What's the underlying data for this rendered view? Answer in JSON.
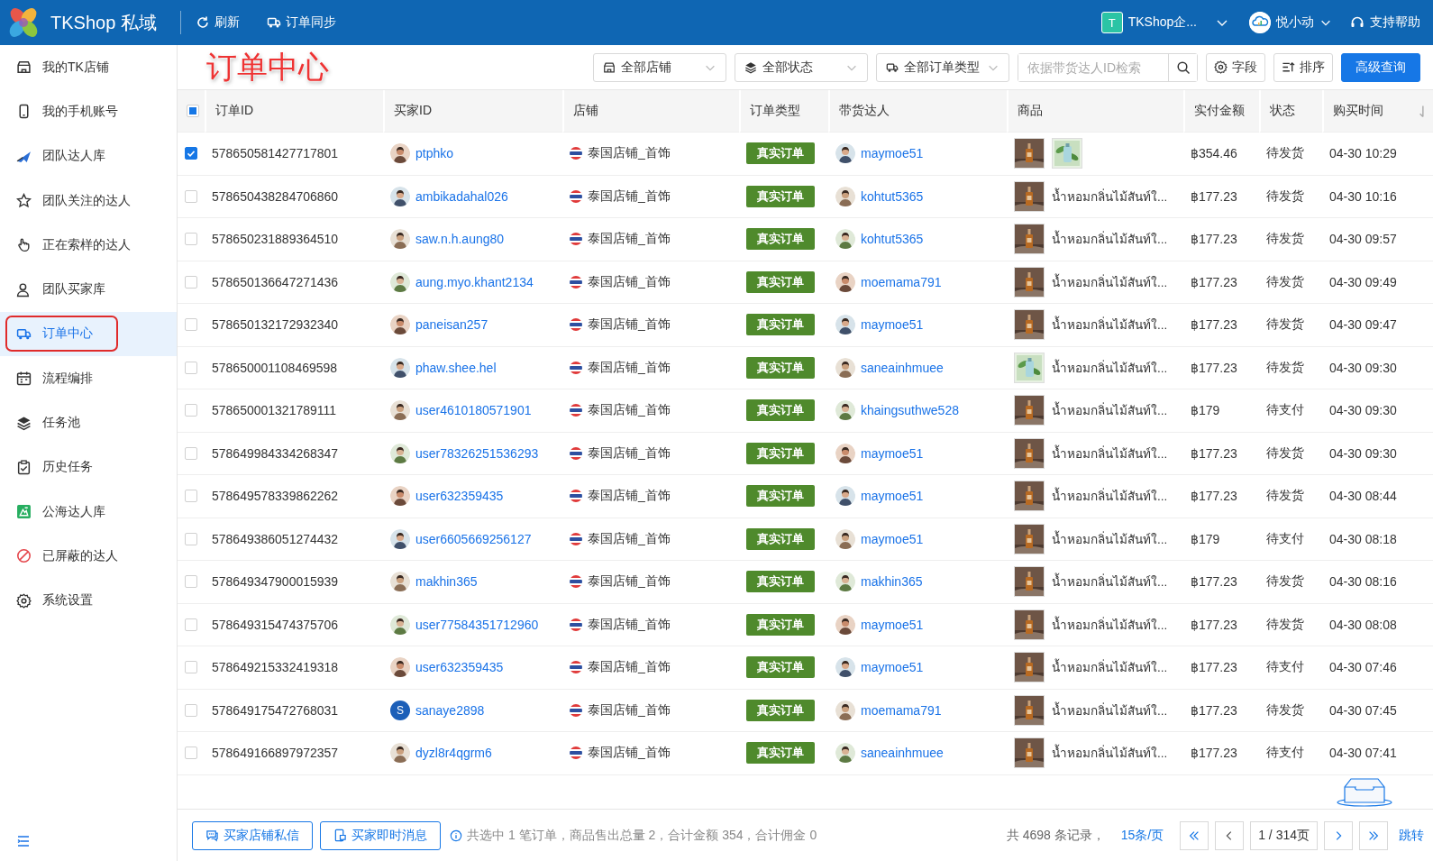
{
  "topbar": {
    "app_name": "TKShop 私域",
    "actions": [
      {
        "label": "刷新",
        "kind": "refresh"
      },
      {
        "label": "订单同步",
        "kind": "truck"
      }
    ],
    "team": {
      "letter": "T",
      "name": "TKShop企..."
    },
    "user": {
      "name": "悦小动"
    },
    "help": "支持帮助"
  },
  "sidebar": {
    "items": [
      {
        "label": "我的TK店铺",
        "kind": "shop",
        "selected": false
      },
      {
        "label": "我的手机账号",
        "kind": "phone",
        "selected": false
      },
      {
        "label": "团队达人库",
        "kind": "plane",
        "selected": false
      },
      {
        "label": "团队关注的达人",
        "kind": "star",
        "selected": false
      },
      {
        "label": "正在索样的达人",
        "kind": "hand",
        "selected": false
      },
      {
        "label": "团队买家库",
        "kind": "user",
        "selected": false
      },
      {
        "label": "订单中心",
        "kind": "truck",
        "selected": true
      },
      {
        "label": "流程编排",
        "kind": "calendar",
        "selected": false
      },
      {
        "label": "任务池",
        "kind": "layers",
        "selected": false
      },
      {
        "label": "历史任务",
        "kind": "clipboard",
        "selected": false
      },
      {
        "label": "公海达人库",
        "kind": "public",
        "selected": false
      },
      {
        "label": "已屏蔽的达人",
        "kind": "ban",
        "selected": false
      },
      {
        "label": "系统设置",
        "kind": "gear",
        "selected": false
      }
    ]
  },
  "toolbar": {
    "annotation": "订单中心",
    "filters": [
      {
        "label": "全部店铺",
        "kind": "shop"
      },
      {
        "label": "全部状态",
        "kind": "layers"
      },
      {
        "label": "全部订单类型",
        "kind": "truck"
      }
    ],
    "search": {
      "placeholder": "依据带货达人ID检索"
    },
    "buttons": [
      {
        "label": "字段",
        "kind": "gear"
      },
      {
        "label": "排序",
        "kind": "sort"
      },
      {
        "label": "高级查询",
        "kind": "primary"
      }
    ]
  },
  "table": {
    "indeterminate": true,
    "columns": [
      {
        "label": "订单ID",
        "sorted": false
      },
      {
        "label": "买家ID",
        "sorted": false
      },
      {
        "label": "店铺",
        "sorted": false
      },
      {
        "label": "订单类型",
        "sorted": false
      },
      {
        "label": "带货达人",
        "sorted": false
      },
      {
        "label": "商品",
        "sorted": false
      },
      {
        "label": "实付金额",
        "sorted": false
      },
      {
        "label": "状态",
        "sorted": false
      },
      {
        "label": "购买时间",
        "sorted": true
      }
    ],
    "rows": [
      {
        "selected": true,
        "order_id": "578650581427717801",
        "buyer": "ptphko",
        "store": "泰国店铺_首饰",
        "order_type": "真实订单",
        "creator": "maymoe51",
        "thumbs": [
          {
            "kind": "bottle"
          },
          {
            "kind": "plant"
          }
        ],
        "amount": "฿354.46",
        "status": "待发货",
        "time": "04-30 10:29"
      },
      {
        "selected": false,
        "order_id": "578650438284706860",
        "buyer": "ambikadahal026",
        "store": "泰国店铺_首饰",
        "order_type": "真实订单",
        "creator": "kohtut5365",
        "thumbs": [
          {
            "kind": "bottle"
          }
        ],
        "product": "น้ำหอมกลิ่นไม้สันท์ใ...",
        "amount": "฿177.23",
        "status": "待发货",
        "time": "04-30 10:16"
      },
      {
        "selected": false,
        "order_id": "578650231889364510",
        "buyer": "saw.n.h.aung80",
        "store": "泰国店铺_首饰",
        "order_type": "真实订单",
        "creator": "kohtut5365",
        "thumbs": [
          {
            "kind": "bottle"
          }
        ],
        "product": "น้ำหอมกลิ่นไม้สันท์ใ...",
        "amount": "฿177.23",
        "status": "待发货",
        "time": "04-30 09:57"
      },
      {
        "selected": false,
        "order_id": "578650136647271436",
        "buyer": "aung.myo.khant2134",
        "store": "泰国店铺_首饰",
        "order_type": "真实订单",
        "creator": "moemama791",
        "thumbs": [
          {
            "kind": "bottle"
          }
        ],
        "product": "น้ำหอมกลิ่นไม้สันท์ใ...",
        "amount": "฿177.23",
        "status": "待发货",
        "time": "04-30 09:49"
      },
      {
        "selected": false,
        "order_id": "578650132172932340",
        "buyer": "paneisan257",
        "store": "泰国店铺_首饰",
        "order_type": "真实订单",
        "creator": "maymoe51",
        "thumbs": [
          {
            "kind": "bottle"
          }
        ],
        "product": "น้ำหอมกลิ่นไม้สันท์ใ...",
        "amount": "฿177.23",
        "status": "待发货",
        "time": "04-30 09:47"
      },
      {
        "selected": false,
        "order_id": "578650001108469598",
        "buyer": "phaw.shee.hel",
        "store": "泰国店铺_首饰",
        "order_type": "真实订单",
        "creator": "saneainhmuee",
        "thumbs": [
          {
            "kind": "plant"
          }
        ],
        "product": "น้ำหอมกลิ่นไม้สันท์ใ...",
        "amount": "฿177.23",
        "status": "待发货",
        "time": "04-30 09:30"
      },
      {
        "selected": false,
        "order_id": "578650001321789111",
        "buyer": "user4610180571901",
        "store": "泰国店铺_首饰",
        "order_type": "真实订单",
        "creator": "khaingsuthwe528",
        "thumbs": [
          {
            "kind": "bottle"
          }
        ],
        "product": "น้ำหอมกลิ่นไม้สันท์ใ...",
        "amount": "฿179",
        "status": "待支付",
        "time": "04-30 09:30"
      },
      {
        "selected": false,
        "order_id": "578649984334268347",
        "buyer": "user78326251536293",
        "store": "泰国店铺_首饰",
        "order_type": "真实订单",
        "creator": "maymoe51",
        "thumbs": [
          {
            "kind": "bottle"
          }
        ],
        "product": "น้ำหอมกลิ่นไม้สันท์ใ...",
        "amount": "฿177.23",
        "status": "待发货",
        "time": "04-30 09:30"
      },
      {
        "selected": false,
        "order_id": "578649578339862262",
        "buyer": "user632359435",
        "store": "泰国店铺_首饰",
        "order_type": "真实订单",
        "creator": "maymoe51",
        "thumbs": [
          {
            "kind": "bottle"
          }
        ],
        "product": "น้ำหอมกลิ่นไม้สันท์ใ...",
        "amount": "฿177.23",
        "status": "待发货",
        "time": "04-30 08:44"
      },
      {
        "selected": false,
        "order_id": "578649386051274432",
        "buyer": "user6605669256127",
        "store": "泰国店铺_首饰",
        "order_type": "真实订单",
        "creator": "maymoe51",
        "thumbs": [
          {
            "kind": "bottle"
          }
        ],
        "product": "น้ำหอมกลิ่นไม้สันท์ใ...",
        "amount": "฿179",
        "status": "待支付",
        "time": "04-30 08:18"
      },
      {
        "selected": false,
        "order_id": "578649347900015939",
        "buyer": "makhin365",
        "store": "泰国店铺_首饰",
        "order_type": "真实订单",
        "creator": "makhin365",
        "thumbs": [
          {
            "kind": "bottle"
          }
        ],
        "product": "น้ำหอมกลิ่นไม้สันท์ใ...",
        "amount": "฿177.23",
        "status": "待发货",
        "time": "04-30 08:16"
      },
      {
        "selected": false,
        "order_id": "578649315474375706",
        "buyer": "user77584351712960",
        "store": "泰国店铺_首饰",
        "order_type": "真实订单",
        "creator": "maymoe51",
        "thumbs": [
          {
            "kind": "bottle"
          }
        ],
        "product": "น้ำหอมกลิ่นไม้สันท์ใ...",
        "amount": "฿177.23",
        "status": "待发货",
        "time": "04-30 08:08"
      },
      {
        "selected": false,
        "order_id": "578649215332419318",
        "buyer": "user632359435",
        "store": "泰国店铺_首饰",
        "order_type": "真实订单",
        "creator": "maymoe51",
        "thumbs": [
          {
            "kind": "bottle"
          }
        ],
        "product": "น้ำหอมกลิ่นไม้สันท์ใ...",
        "amount": "฿177.23",
        "status": "待支付",
        "time": "04-30 07:46"
      },
      {
        "selected": false,
        "order_id": "578649175472768031",
        "buyer": "sanaye2898",
        "buyer_avatar": "S",
        "store": "泰国店铺_首饰",
        "order_type": "真实订单",
        "creator": "moemama791",
        "thumbs": [
          {
            "kind": "bottle"
          }
        ],
        "product": "น้ำหอมกลิ่นไม้สันท์ใ...",
        "amount": "฿177.23",
        "status": "待发货",
        "time": "04-30 07:45"
      },
      {
        "selected": false,
        "order_id": "578649166897972357",
        "buyer": "dyzl8r4qgrm6",
        "store": "泰国店铺_首饰",
        "order_type": "真实订单",
        "creator": "saneainhmuee",
        "thumbs": [
          {
            "kind": "bottle"
          }
        ],
        "product": "น้ำหอมกลิ่นไม้สันท์ใ...",
        "amount": "฿177.23",
        "status": "待支付",
        "time": "04-30 07:41"
      }
    ]
  },
  "footer": {
    "buttons": [
      {
        "label": "买家店铺私信",
        "kind": "chat"
      },
      {
        "label": "买家即时消息",
        "kind": "message"
      }
    ],
    "summary": "共选中 1 笔订单，商品售出总量 2，合计金额 354，合计佣金 0",
    "total": "共 4698 条记录，",
    "page_size": "15条/页",
    "page": "1 / 314页",
    "jump": "跳转"
  }
}
